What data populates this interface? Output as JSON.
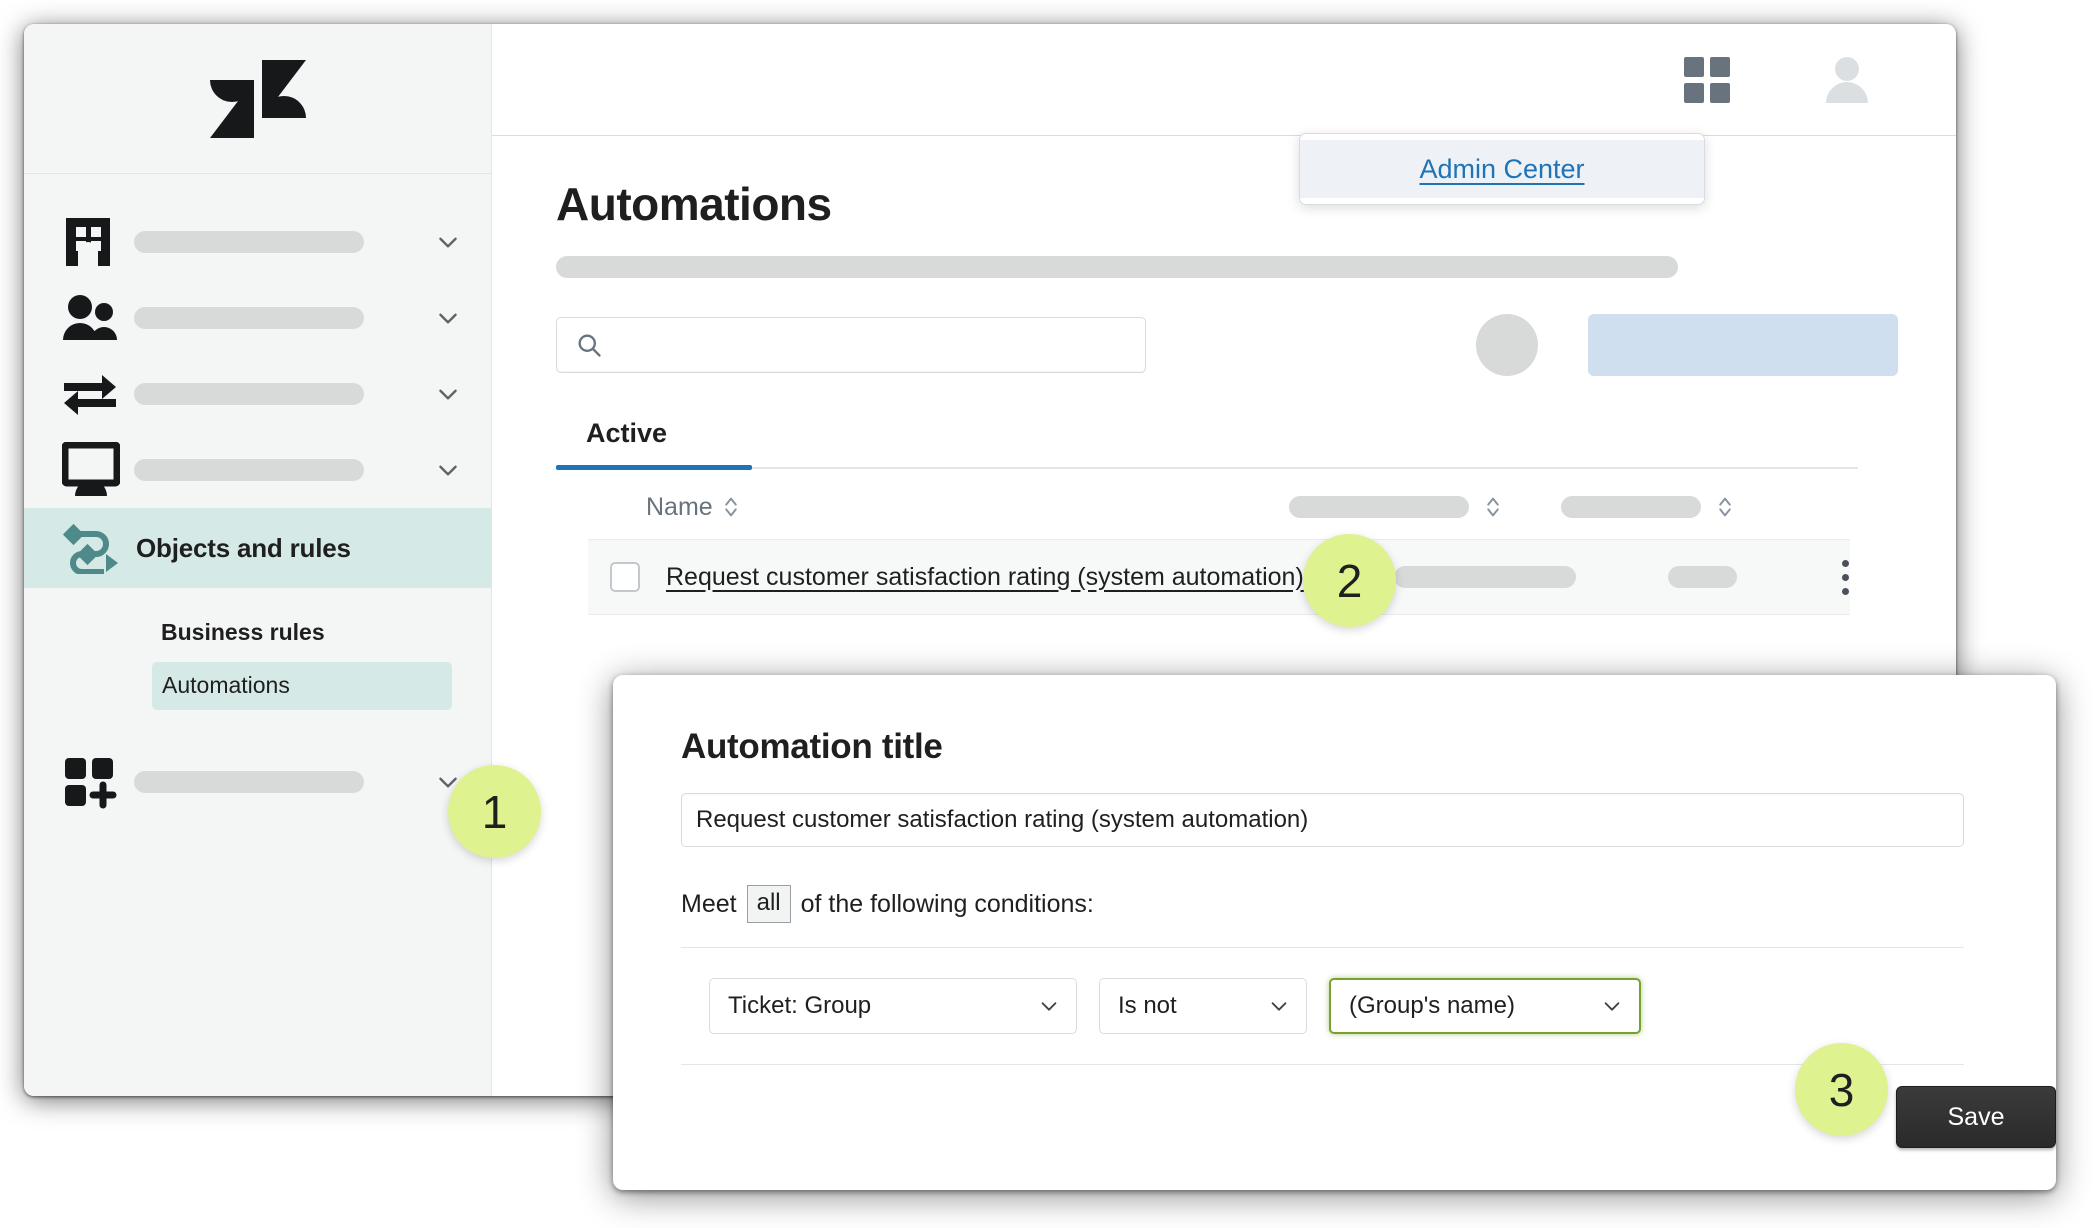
{
  "app": {
    "logo_icon": "zendesk-logo"
  },
  "sidebar": {
    "items": [
      {
        "icon": "building-icon",
        "label": "",
        "chevron": "chevron-down-icon"
      },
      {
        "icon": "people-icon",
        "label": "",
        "chevron": "chevron-down-icon"
      },
      {
        "icon": "transfer-arrows-icon",
        "label": "",
        "chevron": "chevron-down-icon"
      },
      {
        "icon": "monitor-icon",
        "label": "",
        "chevron": "chevron-down-icon"
      }
    ],
    "active_item": {
      "icon": "objects-rules-icon",
      "label": "Objects and rules"
    },
    "sub_heading": "Business rules",
    "sub_items": [
      {
        "label": "Automations",
        "selected": true
      }
    ],
    "last_item": {
      "icon": "apps-plus-icon",
      "chevron": "chevron-down-icon"
    }
  },
  "topbar": {
    "grid_icon": "grid-apps-icon",
    "avatar_icon": "user-avatar-icon"
  },
  "popover": {
    "admin_center_label": "Admin Center"
  },
  "main": {
    "page_title": "Automations",
    "search": {
      "value": "",
      "placeholder": "",
      "icon": "search-icon"
    },
    "tabs": [
      {
        "label": "Active",
        "active": true
      }
    ],
    "table": {
      "columns": [
        {
          "label": "Name",
          "sort_icon": "sort-caret-icon"
        },
        {
          "label": "",
          "sort_icon": "sort-caret-icon"
        },
        {
          "label": "",
          "sort_icon": "sort-caret-icon"
        }
      ],
      "rows": [
        {
          "checked": false,
          "name": "Request customer satisfaction rating (system automation)",
          "menu_icon": "kebab-menu-icon"
        }
      ]
    }
  },
  "modal": {
    "heading": "Automation title",
    "title_value": "Request customer satisfaction rating (system automation)",
    "meet_prefix": "Meet",
    "meet_chip": "all",
    "meet_suffix": "of the following conditions:",
    "condition": {
      "field": "Ticket: Group",
      "operator": "Is not",
      "value": "(Group's name)",
      "chevron_icon": "chevron-down-icon"
    },
    "save_label": "Save"
  },
  "badges": [
    {
      "number": "1"
    },
    {
      "number": "2"
    },
    {
      "number": "3"
    }
  ],
  "colors": {
    "accent_teal": "#d5e9e6",
    "accent_blue": "#1f73b7",
    "badge_green": "#dff290",
    "focus_green": "#78a22f",
    "placeholder_gray": "#d8d9d9"
  }
}
